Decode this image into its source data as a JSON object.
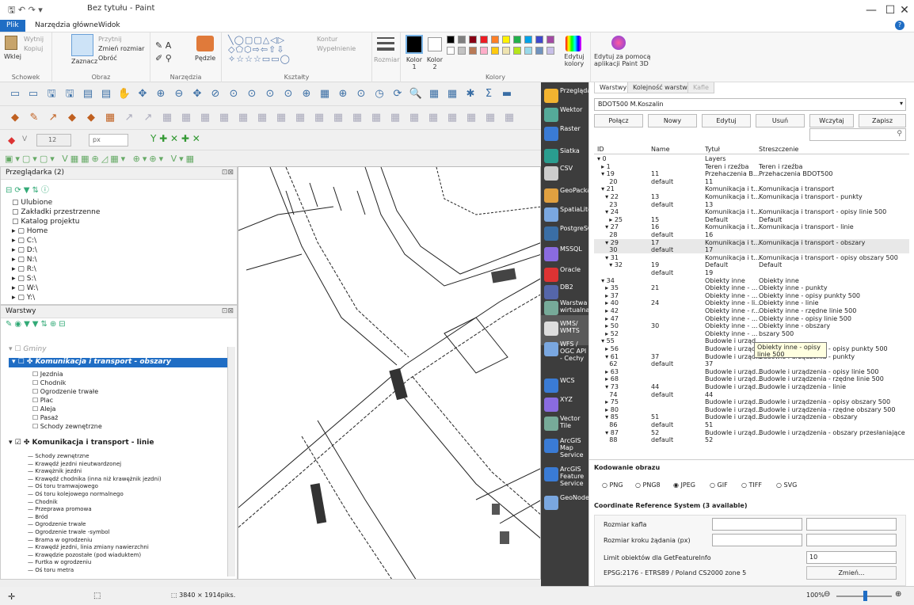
{
  "window": {
    "title": "Bez tytułu - Paint",
    "quick_access": "🖫 ↶ ↷ ▾",
    "min": "—",
    "max": "☐",
    "close": "✕"
  },
  "tabs": [
    "Plik",
    "Narzędzia główne",
    "Widok"
  ],
  "ribbon": {
    "clipboard": {
      "caption": "Schowek",
      "paste": "Wklej",
      "cut": "Wytnij",
      "copy": "Kopiuj"
    },
    "image": {
      "caption": "Obraz",
      "select": "Zaznacz",
      "crop": "Przytnij",
      "resize": "Zmień rozmiar",
      "rotate": "Obróć"
    },
    "tools": {
      "caption": "Narzędzia",
      "brushes": "Pędzle"
    },
    "shapes": {
      "caption": "Kształty",
      "outline": "Kontur",
      "fill": "Wypełnienie"
    },
    "size": "Rozmiar",
    "color1": "Kolor 1",
    "color2": "Kolor 2",
    "colors_caption": "Kolory",
    "edit_colors": "Edytuj kolory",
    "paint3d": "Edytuj za pomocą aplikacji Paint 3D",
    "palette": [
      "#000000",
      "#7f7f7f",
      "#880015",
      "#ed1c24",
      "#ff7f27",
      "#fff200",
      "#22b14c",
      "#00a2e8",
      "#3f48cc",
      "#a349a4",
      "#ffffff",
      "#c3c3c3",
      "#b97a57",
      "#ffaec9",
      "#ffc90e",
      "#efe4b0",
      "#b5e61d",
      "#99d9ea",
      "#7092be",
      "#c8bfe7"
    ]
  },
  "qgis": {
    "font_size": "12",
    "unit": "px",
    "browser": {
      "title": "Przeglądarka (2)",
      "items": [
        "Ulubione",
        "Zakładki przestrzenne",
        "Katalog projektu",
        "Home",
        "C:\\",
        "D:\\",
        "N:\\",
        "R:\\",
        "S:\\",
        "W:\\",
        "Y:\\"
      ]
    },
    "layers": {
      "title": "Warstwy",
      "group": "Gminy",
      "selected": "Komunikacja i transport - obszary",
      "sub1": [
        "Jezdnia",
        "Chodnik",
        "Ogrodzenie trwałe",
        "Plac",
        "Aleja",
        "Pasaż",
        "Schody zewnętrzne"
      ],
      "layer2": "Komunikacja i transport - linie",
      "sub2": [
        "Schody zewnętrzne",
        "Krawędź jezdni nieutwardzonej",
        "Krawężnik jezdni",
        "Krawędź chodnika (inna niż krawężnik jezdni)",
        "Oś toru tramwajowego",
        "Oś toru kolejowego normalnego",
        "Chodnik",
        "Przeprawa promowa",
        "Bród",
        "Ogrodzenie trwałe",
        "Ogrodzenie trwałe -symbol",
        "Brama w ogrodzeniu",
        "Krawędź jezdni, linia zmiany nawierzchni",
        "Krawędzie pozostałe (pod wiaduktem)",
        "Furtka w ogrodzeniu",
        "Oś toru metra"
      ]
    },
    "status_size": "3840 × 1914piks.",
    "zoom": "100%"
  },
  "sources": [
    "Przeglądarka",
    "Wektor",
    "Raster",
    "Siatka",
    "CSV",
    "GeoPackage",
    "SpatiaLite",
    "PostgreSQL",
    "MSSQL",
    "Oracle",
    "DB2",
    "Warstwa wirtualna",
    "WMS/ WMTS",
    "WFS / OGC API - Cechy",
    "WCS",
    "XYZ",
    "Vector Tile",
    "ArcGIS Map Service",
    "ArcGIS Feature Service",
    "GeoNode"
  ],
  "panel": {
    "tabs": [
      "Warstwy",
      "Kolejność warstw",
      "Kafle"
    ],
    "connection": "BDOT500 M.Koszalin",
    "buttons": [
      "Połącz",
      "Nowy",
      "Edytuj",
      "Usuń",
      "Wczytaj",
      "Zapisz"
    ],
    "cols": [
      "ID",
      "Name",
      "Tytuł",
      "Streszczenie"
    ],
    "rows": [
      [
        "▾ 0",
        "",
        "Layers",
        ""
      ],
      [
        "  ▸ 1",
        "",
        "Teren i rzeźba",
        "Teren i rzeźba"
      ],
      [
        "  ▾ 19",
        "11",
        "Przehaczenia B...",
        "Przehaczenia BDOT500"
      ],
      [
        "      20",
        "default",
        "11",
        ""
      ],
      [
        "  ▾ 21",
        "",
        "Komunikacja i t...",
        "Komunikacja i transport"
      ],
      [
        "    ▾ 22",
        "13",
        "Komunikacja i t...",
        "Komunikacja i transport - punkty"
      ],
      [
        "      23",
        "default",
        "13",
        ""
      ],
      [
        "    ▾ 24",
        "",
        "Komunikacja i t...",
        "Komunikacja i transport - opisy linie 500"
      ],
      [
        "      ▸ 25",
        "15",
        "Default",
        "Default"
      ],
      [
        "    ▾ 27",
        "16",
        "Komunikacja i t...",
        "Komunikacja i transport - linie"
      ],
      [
        "      28",
        "default",
        "16",
        ""
      ],
      [
        "    ▾ 29",
        "17",
        "Komunikacja i t...",
        "Komunikacja i transport - obszary"
      ],
      [
        "      30",
        "default",
        "17",
        ""
      ],
      [
        "    ▾ 31",
        "",
        "Komunikacja i t...",
        "Komunikacja i transport - opisy obszary 500"
      ],
      [
        "      ▾ 32",
        "19",
        "Default",
        "Default"
      ],
      [
        "        ",
        "default",
        "19",
        ""
      ],
      [
        "  ▾ 34",
        "",
        "Obiekty inne",
        "Obiekty inne"
      ],
      [
        "    ▸ 35",
        "21",
        "Obiekty inne - ...",
        "Obiekty inne - punkty"
      ],
      [
        "    ▸ 37",
        "",
        "Obiekty inne - ...",
        "Obiekty inne - opisy punkty 500"
      ],
      [
        "    ▸ 40",
        "24",
        "Obiekty inne - li...",
        "Obiekty inne - linie"
      ],
      [
        "    ▸ 42",
        "",
        "Obiekty inne - r...",
        "Obiekty inne - rzędne linie 500"
      ],
      [
        "    ▸ 47",
        "",
        "Obiekty inne - ...",
        "Obiekty inne - opisy linie 500"
      ],
      [
        "    ▸ 50",
        "30",
        "Obiekty inne - ...",
        "Obiekty inne - obszary"
      ],
      [
        "    ▸ 52",
        "",
        "Obiekty inne - ...",
        "bszary 500"
      ],
      [
        "  ▾ 55",
        "",
        "Budowle i urząd...",
        ""
      ],
      [
        "    ▸ 56",
        "",
        "Budowle i urząd...",
        "Budowle i urządzenia - opisy punkty 500"
      ],
      [
        "    ▾ 61",
        "37",
        "Budowle i urząd...",
        "Budowle i urządzenia - punkty"
      ],
      [
        "      62",
        "default",
        "37",
        ""
      ],
      [
        "    ▸ 63",
        "",
        "Budowle i urząd...",
        "Budowle i urządzenia - opisy linie 500"
      ],
      [
        "    ▸ 68",
        "",
        "Budowle i urząd...",
        "Budowle i urządzenia - rzędne linie 500"
      ],
      [
        "    ▾ 73",
        "44",
        "Budowle i urząd...",
        "Budowle i urządzenia - linie"
      ],
      [
        "      74",
        "default",
        "44",
        ""
      ],
      [
        "    ▸ 75",
        "",
        "Budowle i urząd...",
        "Budowle i urządzenia - opisy obszary 500"
      ],
      [
        "    ▸ 80",
        "",
        "Budowle i urząd...",
        "Budowle i urządzenia - rzędne obszary 500"
      ],
      [
        "    ▾ 85",
        "51",
        "Budowle i urząd...",
        "Budowle i urządzenia - obszary"
      ],
      [
        "      86",
        "default",
        "51",
        ""
      ],
      [
        "    ▾ 87",
        "52",
        "Budowle i urząd...",
        "Budowle i urządzenia - obszary przesłaniające"
      ],
      [
        "      88",
        "default",
        "52",
        ""
      ]
    ],
    "tooltip": "Obiekty inne - opisy linie 500",
    "encoding_title": "Kodowanie obrazu",
    "formats": [
      "PNG",
      "PNG8",
      "JPEG",
      "GIF",
      "TIFF",
      "SVG"
    ],
    "crs_title": "Coordinate Reference System (3 available)",
    "tile_size": "Rozmiar kafla",
    "step": "Rozmiar kroku żądania (px)",
    "limit": "Limit obiektów dla GetFeatureInfo",
    "limit_val": "10",
    "crs": "EPSG:2176 - ETRS89 / Poland CS2000 zone 5",
    "change": "Zmień..."
  }
}
